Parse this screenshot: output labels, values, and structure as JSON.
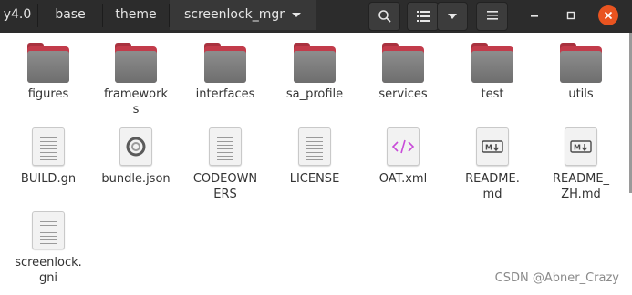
{
  "breadcrumbs": [
    "y4.0",
    "base",
    "theme",
    "screenlock_mgr"
  ],
  "colors": {
    "headerbar": "#2c2c2c",
    "folder_accent": "#c23b4a",
    "close_button": "#e95420",
    "xml_icon": "#c84bd8"
  },
  "header_icons": [
    "search-icon",
    "list-view-icon",
    "view-options-chevron-icon",
    "menu-icon",
    "minimize-icon",
    "maximize-icon",
    "close-icon"
  ],
  "folders": [
    {
      "name": "figures",
      "icon": "folder-icon"
    },
    {
      "name": "framework\ns",
      "icon": "folder-icon"
    },
    {
      "name": "interfaces",
      "icon": "folder-icon"
    },
    {
      "name": "sa_profile",
      "icon": "folder-icon"
    },
    {
      "name": "services",
      "icon": "folder-icon"
    },
    {
      "name": "test",
      "icon": "folder-icon"
    },
    {
      "name": "utils",
      "icon": "folder-icon"
    }
  ],
  "files": [
    {
      "name": "BUILD.gn",
      "icon": "text-file-icon"
    },
    {
      "name": "bundle.json",
      "icon": "json-file-icon"
    },
    {
      "name": "CODEOWN\nERS",
      "icon": "text-file-icon"
    },
    {
      "name": "LICENSE",
      "icon": "text-file-icon"
    },
    {
      "name": "OAT.xml",
      "icon": "xml-file-icon"
    },
    {
      "name": "README.\nmd",
      "icon": "markdown-file-icon"
    },
    {
      "name": "README_\nZH.md",
      "icon": "markdown-file-icon"
    },
    {
      "name": "screenlock.\ngni",
      "icon": "text-file-icon"
    }
  ],
  "watermark": "CSDN @Abner_Crazy"
}
